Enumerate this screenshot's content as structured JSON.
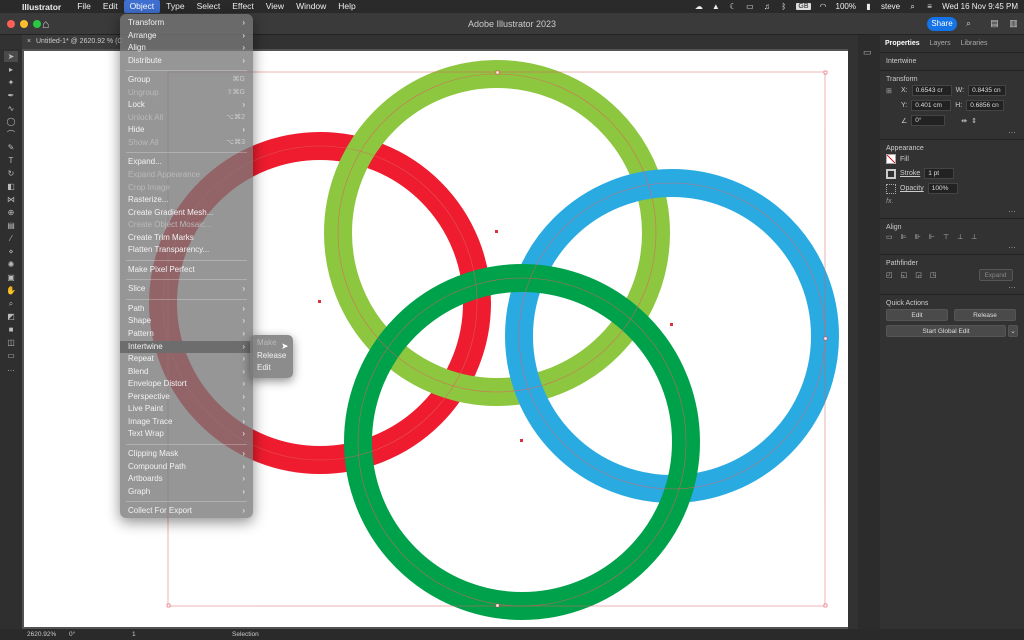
{
  "macos_menubar": {
    "app_name": "Illustrator",
    "menus": [
      "File",
      "Edit",
      "Object",
      "Type",
      "Select",
      "Effect",
      "View",
      "Window",
      "Help"
    ],
    "active_menu": "Object",
    "battery": "100%",
    "datetime": "Wed 16 Nov  9:45 PM",
    "user": "steve",
    "kb_badge": "GB"
  },
  "window": {
    "title": "Adobe Illustrator 2023",
    "share_label": "Share"
  },
  "document_tab": {
    "label": "Untitled-1* @ 2620.92 % (C"
  },
  "object_menu": {
    "items": [
      {
        "label": "Transform",
        "type": "submenu"
      },
      {
        "label": "Arrange",
        "type": "submenu"
      },
      {
        "label": "Align",
        "type": "submenu"
      },
      {
        "label": "Distribute",
        "type": "submenu"
      },
      {
        "type": "separator"
      },
      {
        "label": "Group",
        "shortcut": "⌘G"
      },
      {
        "label": "Ungroup",
        "shortcut": "⇧⌘G",
        "disabled": true
      },
      {
        "label": "Lock",
        "type": "submenu"
      },
      {
        "label": "Unlock All",
        "shortcut": "⌥⌘2",
        "disabled": true
      },
      {
        "label": "Hide",
        "type": "submenu"
      },
      {
        "label": "Show All",
        "shortcut": "⌥⌘3",
        "disabled": true
      },
      {
        "type": "separator"
      },
      {
        "label": "Expand..."
      },
      {
        "label": "Expand Appearance",
        "disabled": true
      },
      {
        "label": "Crop Image",
        "disabled": true
      },
      {
        "label": "Rasterize..."
      },
      {
        "label": "Create Gradient Mesh..."
      },
      {
        "label": "Create Object Mosaic...",
        "disabled": true
      },
      {
        "label": "Create Trim Marks"
      },
      {
        "label": "Flatten Transparency..."
      },
      {
        "type": "separator"
      },
      {
        "label": "Make Pixel Perfect"
      },
      {
        "type": "separator"
      },
      {
        "label": "Slice",
        "type": "submenu"
      },
      {
        "type": "separator"
      },
      {
        "label": "Path",
        "type": "submenu"
      },
      {
        "label": "Shape",
        "type": "submenu"
      },
      {
        "label": "Pattern",
        "type": "submenu"
      },
      {
        "label": "Intertwine",
        "type": "submenu",
        "highlighted": true
      },
      {
        "label": "Repeat",
        "type": "submenu"
      },
      {
        "label": "Blend",
        "type": "submenu"
      },
      {
        "label": "Envelope Distort",
        "type": "submenu"
      },
      {
        "label": "Perspective",
        "type": "submenu"
      },
      {
        "label": "Live Paint",
        "type": "submenu"
      },
      {
        "label": "Image Trace",
        "type": "submenu"
      },
      {
        "label": "Text Wrap",
        "type": "submenu"
      },
      {
        "type": "separator"
      },
      {
        "label": "Clipping Mask",
        "type": "submenu"
      },
      {
        "label": "Compound Path",
        "type": "submenu"
      },
      {
        "label": "Artboards",
        "type": "submenu"
      },
      {
        "label": "Graph",
        "type": "submenu"
      },
      {
        "type": "separator"
      },
      {
        "label": "Collect For Export",
        "type": "submenu"
      }
    ]
  },
  "intertwine_submenu": {
    "items": [
      {
        "label": "Make",
        "disabled": true
      },
      {
        "label": "Release"
      },
      {
        "label": "Edit"
      }
    ]
  },
  "right_panel": {
    "tabs": [
      "Properties",
      "Layers",
      "Libraries"
    ],
    "selection_type": "Intertwine",
    "transform": {
      "title": "Transform",
      "x_label": "X:",
      "x": "0.6543 cr",
      "y_label": "Y:",
      "y": "0.401 cm",
      "w_label": "W:",
      "w": "0.8435 cn",
      "h_label": "H:",
      "h": "0.6856 cn",
      "angle": "0°"
    },
    "appearance": {
      "title": "Appearance",
      "fill_label": "Fill",
      "stroke_label": "Stroke",
      "stroke_value": "1 pt",
      "opacity_label": "Opacity",
      "opacity_value": "100%",
      "fx_label": "fx."
    },
    "align": {
      "title": "Align"
    },
    "pathfinder": {
      "title": "Pathfinder",
      "expand_label": "Expand"
    },
    "quick_actions": {
      "title": "Quick Actions",
      "edit_label": "Edit",
      "release_label": "Release",
      "global_edit_label": "Start Global Edit"
    }
  },
  "statusbar": {
    "zoom": "2620.92%",
    "rotation": "0°",
    "artboard": "1",
    "tool": "Selection"
  },
  "colors": {
    "red_ring": "#ee1c2e",
    "lime_ring": "#8dc63f",
    "blue_ring": "#29abe2",
    "green_ring": "#00a14b",
    "accent": "#1473e6"
  }
}
